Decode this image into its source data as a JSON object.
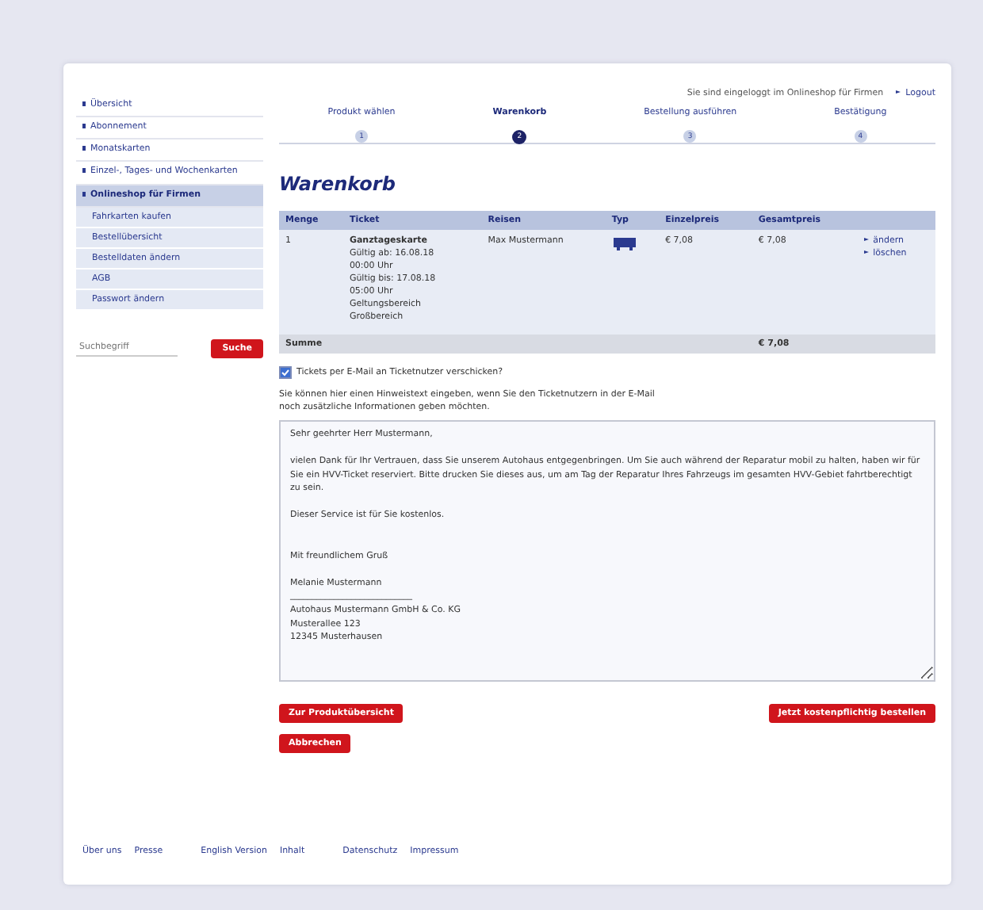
{
  "sidebar": {
    "items": [
      {
        "label": "Übersicht",
        "selected": false
      },
      {
        "label": "Abonnement",
        "selected": false
      },
      {
        "label": "Monatskarten",
        "selected": false
      },
      {
        "label": "Einzel-, Tages- und Wochenkarten",
        "selected": false
      },
      {
        "label": "Onlineshop für Firmen",
        "selected": true,
        "children": [
          {
            "label": "Fahrkarten kaufen"
          },
          {
            "label": "Bestellübersicht"
          },
          {
            "label": "Bestelldaten ändern"
          },
          {
            "label": "AGB"
          },
          {
            "label": "Passwort ändern"
          }
        ]
      }
    ],
    "search": {
      "placeholder": "Suchbegriff",
      "button": "Suche"
    }
  },
  "login": {
    "text": "Sie sind eingeloggt im Onlineshop für Firmen",
    "logout": "Logout"
  },
  "steps": [
    {
      "label": "Produkt wählen",
      "number": "1",
      "selected": false
    },
    {
      "label": "Warenkorb",
      "number": "2",
      "selected": true
    },
    {
      "label": "Bestellung ausführen",
      "number": "3",
      "selected": false
    },
    {
      "label": "Bestätigung",
      "number": "4",
      "selected": false
    }
  ],
  "heading": "Warenkorb",
  "table": {
    "columns": [
      "Menge",
      "Ticket",
      "Reisen",
      "Typ",
      "Einzelpreis",
      "Gesamtpreis"
    ],
    "rows": [
      {
        "quantity": "1",
        "ticket_title": "Ganztageskarte",
        "ticket_lines": [
          "Gültig ab: 16.08.18",
          "00:00 Uhr",
          "Gültig bis: 17.08.18",
          "05:00 Uhr",
          "Geltungsbereich",
          "Großbereich"
        ],
        "traveller": "Max Mustermann",
        "unit_price": "€ 7,08",
        "total_price": "€ 7,08",
        "actions": [
          "ändern",
          "löschen"
        ]
      }
    ],
    "sum_label": "Summe",
    "sum": "€ 7,08"
  },
  "email_option": {
    "label": "Tickets per E-Mail an Ticketnutzer verschicken?",
    "checked": true
  },
  "hint": "Sie können hier einen Hinweistext eingeben, wenn Sie den Ticketnutzern in der E-Mail noch zusätzliche Informationen geben möchten.",
  "message": {
    "value": "Sehr geehrter Herr Mustermann,\n\nvielen Dank für Ihr Vertrauen, dass Sie unserem Autohaus entgegenbringen. Um Sie auch während der Reparatur mobil zu halten, haben wir für Sie ein HVV-Ticket reserviert. Bitte drucken Sie dieses aus, um am Tag der Reparatur Ihres Fahrzeugs im gesamten HVV-Gebiet fahrtberechtigt zu sein.\n\nDieser Service ist für Sie kostenlos.\n\n\nMit freundlichem Gruß\n\nMelanie Mustermann\n____________________________\nAutohaus Mustermann GmbH & Co. KG\nMusterallee 123\n12345 Musterhausen"
  },
  "buttons": {
    "back": "Zur Produktübersicht",
    "cancel": "Abbrechen",
    "order": "Jetzt kostenpflichtig bestellen"
  },
  "footer": [
    "Über uns",
    "Presse",
    "English Version",
    "Inhalt",
    "Datenschutz",
    "Impressum"
  ]
}
